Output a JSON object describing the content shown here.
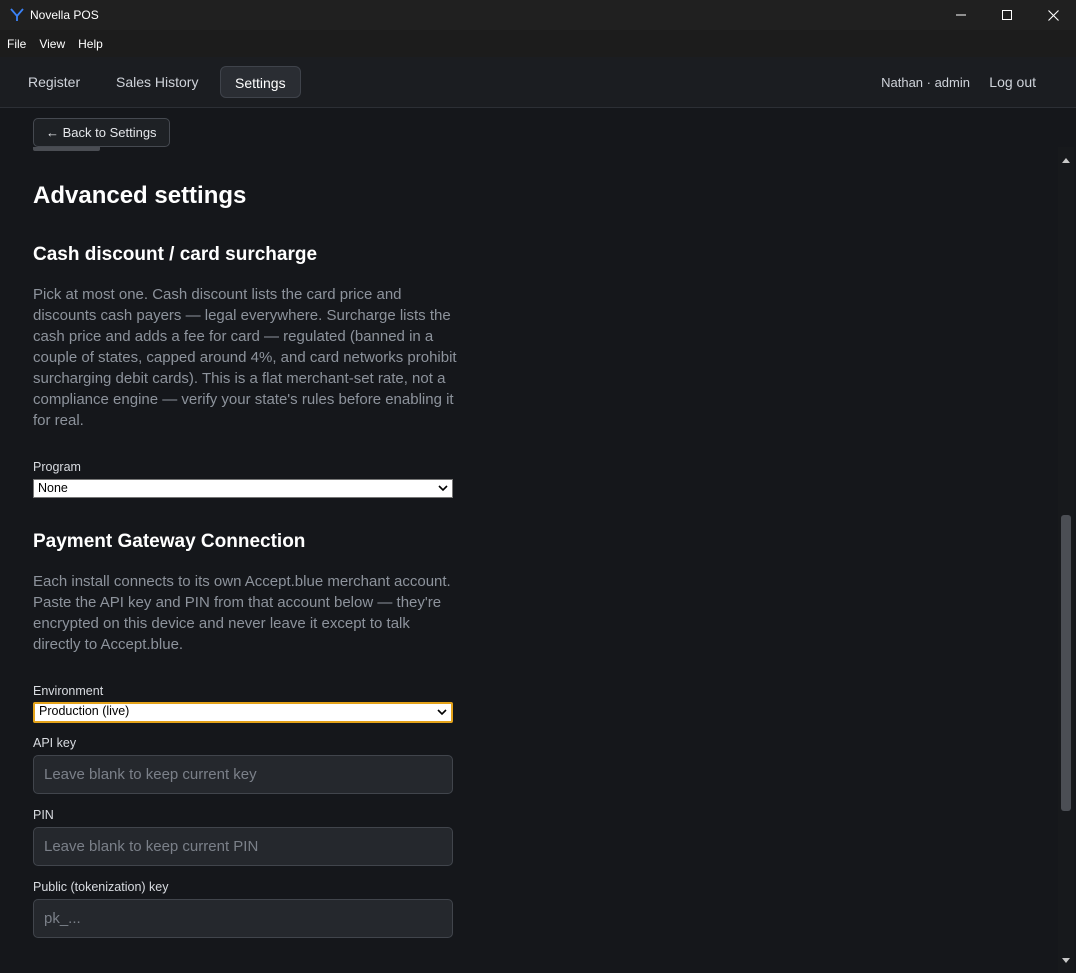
{
  "window": {
    "title": "Novella POS",
    "icon": "app-logo-icon",
    "controls": [
      "minimize-icon",
      "maximize-icon",
      "close-icon"
    ]
  },
  "menu": {
    "items": [
      {
        "label": "File"
      },
      {
        "label": "View"
      },
      {
        "label": "Help"
      }
    ]
  },
  "nav": {
    "tabs": [
      {
        "label": "Register",
        "active": false
      },
      {
        "label": "Sales History",
        "active": false
      },
      {
        "label": "Settings",
        "active": true
      }
    ],
    "user": "Nathan · admin",
    "logout_label": "Log out"
  },
  "content": {
    "back_label": "← Back to Settings",
    "page_title": "Advanced settings",
    "cash": {
      "title": "Cash discount / card surcharge",
      "description": "Pick at most one. Cash discount lists the card price and discounts cash payers — legal everywhere. Surcharge lists the cash price and adds a fee for card — regulated (banned in a couple of states, capped around 4%, and card networks prohibit surcharging debit cards). This is a flat merchant-set rate, not a compliance engine — verify your state's rules before enabling it for real.",
      "program_label": "Program",
      "program_value": "None"
    },
    "gateway": {
      "title": "Payment Gateway Connection",
      "description": "Each install connects to its own Accept.blue merchant account. Paste the API key and PIN from that account below — they're encrypted on this device and never leave it except to talk directly to Accept.blue.",
      "environment_label": "Environment",
      "environment_value": "Production (live)",
      "api_key_label": "API key",
      "api_key_placeholder": "Leave blank to keep current key",
      "pin_label": "PIN",
      "pin_placeholder": "Leave blank to keep current PIN",
      "public_key_label": "Public (tokenization) key",
      "public_key_placeholder": "pk_..."
    }
  },
  "colors": {
    "background": "#15171b",
    "focus_outline": "#e3a21a",
    "muted_text": "#8d939c"
  }
}
